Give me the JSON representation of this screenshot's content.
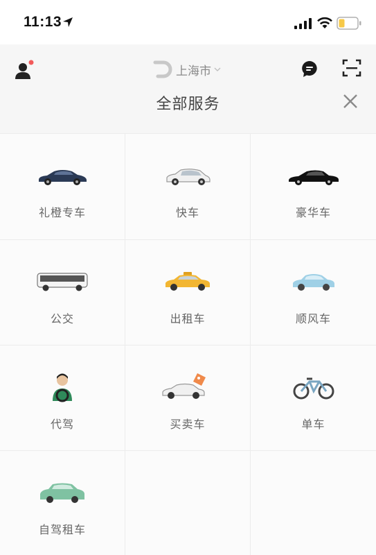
{
  "status_bar": {
    "time": "11:13"
  },
  "header": {
    "city": "上海市",
    "title": "全部服务"
  },
  "icons": {
    "profile": "person-icon",
    "message": "message-bubble-icon",
    "scan": "scan-icon",
    "close": "close-icon",
    "logo": "didi-logo-icon"
  },
  "colors": {
    "notification_dot": "#f25a5a",
    "battery_level": "#f7c948"
  },
  "services": [
    {
      "label": "礼橙专车",
      "icon": "sedan-dark-blue-icon"
    },
    {
      "label": "快车",
      "icon": "hatchback-white-icon"
    },
    {
      "label": "豪华车",
      "icon": "luxury-black-sedan-icon"
    },
    {
      "label": "公交",
      "icon": "bus-icon"
    },
    {
      "label": "出租车",
      "icon": "taxi-icon"
    },
    {
      "label": "顺风车",
      "icon": "compact-car-blue-icon"
    },
    {
      "label": "代驾",
      "icon": "chauffeur-icon"
    },
    {
      "label": "买卖车",
      "icon": "car-with-price-tag-icon"
    },
    {
      "label": "单车",
      "icon": "bicycle-icon"
    },
    {
      "label": "自驾租车",
      "icon": "suv-green-icon"
    }
  ]
}
